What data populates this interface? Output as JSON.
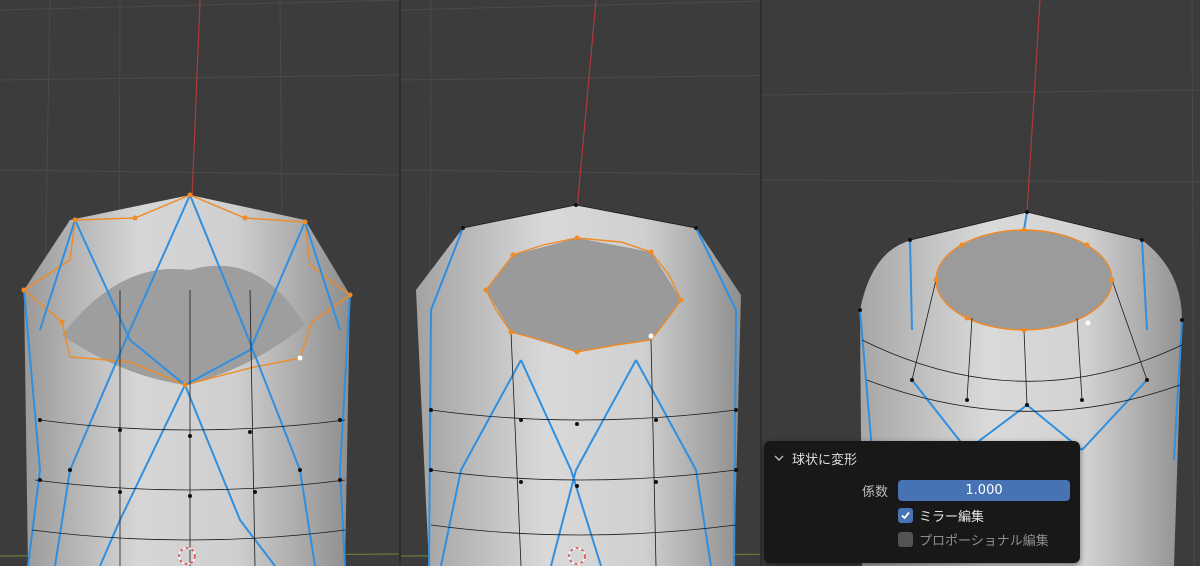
{
  "app": {
    "name": "Blender 3D Viewport"
  },
  "viewports": [
    {
      "id": "before",
      "hole": "star"
    },
    {
      "id": "partial",
      "hole": "octagon"
    },
    {
      "id": "spherized",
      "hole": "circle"
    }
  ],
  "colors": {
    "viewport_bg": "#3c3c3c",
    "grid_line": "#4a4a4a",
    "axis_z": "#b03a3a",
    "axis_y": "#6f8a30",
    "mesh_surface": "#c9c9c9",
    "seam_edge": "#2f8fe0",
    "selected_edge": "#f08a24",
    "vertex": "#111111",
    "active_vertex": "#ffffff",
    "panel_bg": "#181818",
    "field_blue": "#4772b3"
  },
  "operator_panel": {
    "title": "球状に変形",
    "collapse_icon": "chevron-down-icon",
    "factor": {
      "label": "係数",
      "value": "1.000"
    },
    "mirror_edit": {
      "label": "ミラー編集",
      "checked": true
    },
    "proportional_edit": {
      "label": "プロポーショナル編集",
      "checked": false
    }
  }
}
